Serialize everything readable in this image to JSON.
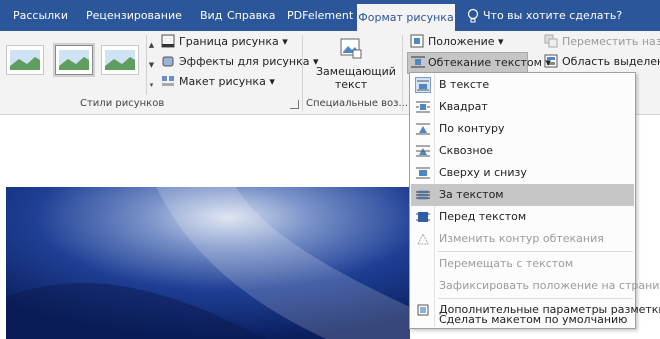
{
  "tabs": [
    {
      "label": "Рассылки"
    },
    {
      "label": "Рецензирование"
    },
    {
      "label": "Вид"
    },
    {
      "label": "Справка"
    },
    {
      "label": "PDFelement"
    },
    {
      "label": "Формат рисунка",
      "active": true
    }
  ],
  "tell_me": "Что вы хотите сделать?",
  "ribbon": {
    "styles_group_label": "Стили рисунков",
    "border_label": "Граница рисунка",
    "effects_label": "Эффекты для рисунка",
    "layout_label": "Макет рисунка",
    "alt_text_line1": "Замещающий",
    "alt_text_line2": "текст",
    "accessibility_group_label": "Специальные воз...",
    "position_label": "Положение",
    "wrap_text_label": "Обтекание текстом",
    "bring_forward_label": "Переместить назад",
    "selection_pane_label": "Область выделения"
  },
  "wrap_menu": {
    "items": [
      {
        "label": "В тексте"
      },
      {
        "label": "Квадрат"
      },
      {
        "label": "По контуру"
      },
      {
        "label": "Сквозное"
      },
      {
        "label": "Сверху и снизу"
      },
      {
        "label": "За текстом"
      },
      {
        "label": "Перед текстом"
      },
      {
        "label": "Изменить контур обтекания"
      },
      {
        "label": "Перемещать с текстом"
      },
      {
        "label": "Зафиксировать положение на странице"
      },
      {
        "label": "Дополнительные параметры разметки..."
      },
      {
        "label": "Сделать макетом по умолчанию"
      }
    ]
  },
  "colors": {
    "ribbon_tabs": "#2b579a",
    "ribbon_body": "#f3f3f3",
    "menu_highlight": "#c6c6c6"
  },
  "icons": [
    "lightbulb-icon",
    "picture-border-icon",
    "picture-effects-icon",
    "picture-layout-icon",
    "alt-text-icon",
    "position-icon",
    "wrap-text-icon",
    "send-backward-icon",
    "selection-pane-icon"
  ]
}
